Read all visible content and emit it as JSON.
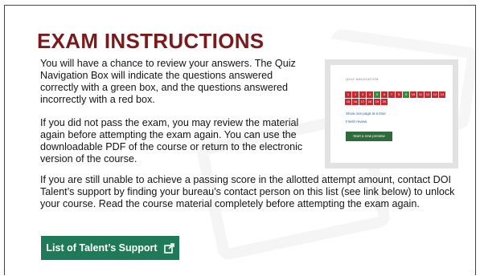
{
  "slide": {
    "title": "EXAM INSTRUCTIONS",
    "paragraphs": [
      "You will have a chance to review your answers. The Quiz Navigation Box will indicate the questions answered correctly with a green box, and the questions answered incorrectly with a red box.",
      "If you did not pass the exam, you may review the material again before attempting the exam again. You can use the downloadable PDF of the course or return to the electronic version of the course.",
      "If you are still unable to achieve a passing score in the allotted attempt amount, contact DOI Talent’s support by finding your bureau’s contact person on this list (see link below) to unlock your course. Read the course material completely before attempting the exam again."
    ],
    "button_label": "List of Talent’s Support",
    "button_icon": "external-link-icon"
  },
  "quiz_navigation": {
    "title": "QUIZ NAVIGATION",
    "cells": [
      {
        "n": "1",
        "status": "red"
      },
      {
        "n": "2",
        "status": "red"
      },
      {
        "n": "3",
        "status": "red"
      },
      {
        "n": "4",
        "status": "red"
      },
      {
        "n": "5",
        "status": "green"
      },
      {
        "n": "6",
        "status": "red"
      },
      {
        "n": "7",
        "status": "red"
      },
      {
        "n": "8",
        "status": "red"
      },
      {
        "n": "9",
        "status": "green"
      },
      {
        "n": "10",
        "status": "red"
      },
      {
        "n": "11",
        "status": "red"
      },
      {
        "n": "12",
        "status": "red"
      },
      {
        "n": "13",
        "status": "red"
      },
      {
        "n": "14",
        "status": "red"
      },
      {
        "n": "15",
        "status": "red"
      },
      {
        "n": "16",
        "status": "red"
      },
      {
        "n": "17",
        "status": "red"
      },
      {
        "n": "18",
        "status": "red"
      },
      {
        "n": "19",
        "status": "red"
      },
      {
        "n": "20",
        "status": "red"
      }
    ],
    "link_show_one_page": "Show one page at a time",
    "link_finish_review": "Finish review",
    "button_start_preview": "Start a new preview"
  },
  "colors": {
    "title": "#7b1a1a",
    "button": "#1e7a58",
    "quiz_red": "#c8282e",
    "quiz_green": "#3c8a3c"
  }
}
